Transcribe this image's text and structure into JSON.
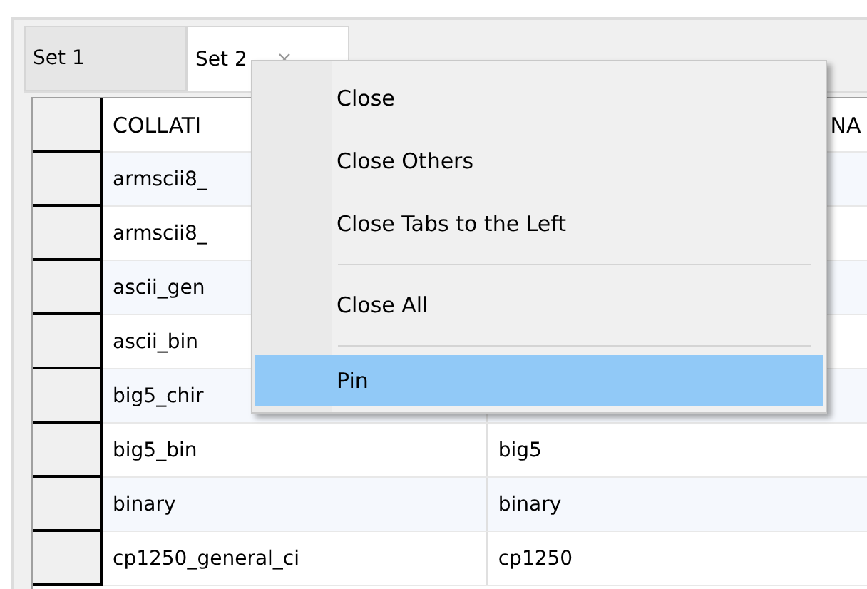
{
  "tabs": [
    {
      "label": "Set 1",
      "selected": false,
      "closable": false
    },
    {
      "label": "Set 2",
      "selected": true,
      "closable": true
    }
  ],
  "table": {
    "columns": [
      "COLLATI",
      "NA"
    ],
    "rows": [
      [
        "armscii8_",
        ""
      ],
      [
        "armscii8_",
        ""
      ],
      [
        "ascii_gen",
        ""
      ],
      [
        "ascii_bin",
        ""
      ],
      [
        "big5_chir",
        ""
      ],
      [
        "big5_bin",
        "big5"
      ],
      [
        "binary",
        "binary"
      ],
      [
        "cp1250_general_ci",
        "cp1250"
      ]
    ]
  },
  "context_menu": {
    "items": [
      {
        "kind": "item",
        "label": "Close",
        "selected": false
      },
      {
        "kind": "item",
        "label": "Close Others",
        "selected": false
      },
      {
        "kind": "item",
        "label": "Close Tabs to the Left",
        "selected": false
      },
      {
        "kind": "separator"
      },
      {
        "kind": "item",
        "label": "Close All",
        "selected": false
      },
      {
        "kind": "separator"
      },
      {
        "kind": "item",
        "label": "Pin",
        "selected": true
      }
    ]
  }
}
